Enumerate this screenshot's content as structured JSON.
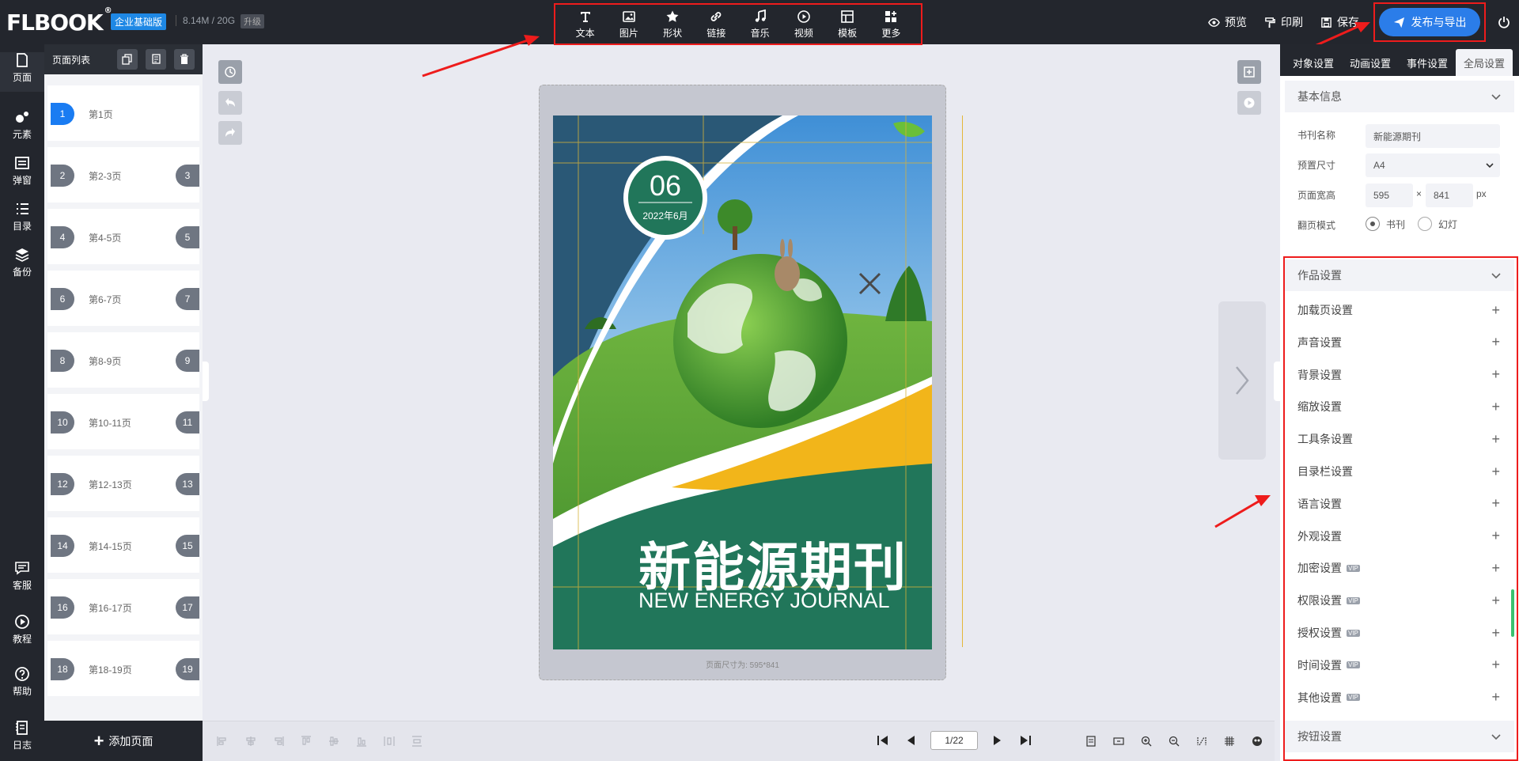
{
  "app": {
    "logo": "FLBOOK",
    "edition": "企业基础版",
    "storage": "8.14M / 20G",
    "upgrade": "升级"
  },
  "toolbar": [
    {
      "label": "文本",
      "icon": "text-icon"
    },
    {
      "label": "图片",
      "icon": "image-icon"
    },
    {
      "label": "形状",
      "icon": "star-icon"
    },
    {
      "label": "链接",
      "icon": "link-icon"
    },
    {
      "label": "音乐",
      "icon": "music-icon"
    },
    {
      "label": "视频",
      "icon": "video-icon"
    },
    {
      "label": "模板",
      "icon": "template-icon"
    },
    {
      "label": "更多",
      "icon": "more-icon"
    }
  ],
  "topright": {
    "preview": "预览",
    "print": "印刷",
    "save": "保存",
    "publish": "发布与导出"
  },
  "leftnav": [
    {
      "label": "页面",
      "icon": "page-icon"
    },
    {
      "label": "元素",
      "icon": "element-icon"
    },
    {
      "label": "弹窗",
      "icon": "popup-icon"
    },
    {
      "label": "目录",
      "icon": "list-icon"
    },
    {
      "label": "备份",
      "icon": "layers-icon"
    },
    {
      "label": "客服",
      "icon": "chat-icon"
    },
    {
      "label": "教程",
      "icon": "play-icon"
    },
    {
      "label": "帮助",
      "icon": "help-icon"
    },
    {
      "label": "日志",
      "icon": "log-icon"
    }
  ],
  "pagelist": {
    "title": "页面列表",
    "pages": [
      {
        "num": "1",
        "label": "第1页",
        "num2": ""
      },
      {
        "num": "2",
        "label": "第2-3页",
        "num2": "3"
      },
      {
        "num": "4",
        "label": "第4-5页",
        "num2": "5"
      },
      {
        "num": "6",
        "label": "第6-7页",
        "num2": "7"
      },
      {
        "num": "8",
        "label": "第8-9页",
        "num2": "9"
      },
      {
        "num": "10",
        "label": "第10-11页",
        "num2": "11"
      },
      {
        "num": "12",
        "label": "第12-13页",
        "num2": "13"
      },
      {
        "num": "14",
        "label": "第14-15页",
        "num2": "15"
      },
      {
        "num": "16",
        "label": "第16-17页",
        "num2": "17"
      },
      {
        "num": "18",
        "label": "第18-19页",
        "num2": "19"
      }
    ],
    "add": "添加页面"
  },
  "cover": {
    "issue": "06",
    "date": "2022年6月",
    "title_cn": "新能源期刊",
    "title_en": "NEW ENERGY JOURNAL",
    "colors": {
      "navy": "#2a5876",
      "green": "#21765a",
      "yellow": "#f2b51a"
    }
  },
  "canvas": {
    "size_label": "页面尺寸为: 595*841"
  },
  "pager": {
    "value": "1/22"
  },
  "rightpanel": {
    "tabs": [
      "对象设置",
      "动画设置",
      "事件设置",
      "全局设置"
    ],
    "basic": {
      "title": "基本信息",
      "name_label": "书刊名称",
      "name_value": "新能源期刊",
      "size_label": "预置尺寸",
      "size_value": "A4",
      "wh_label": "页面宽高",
      "width": "595",
      "x": "×",
      "height": "841",
      "unit": "px",
      "mode_label": "翻页模式",
      "mode_book": "书刊",
      "mode_slide": "幻灯"
    },
    "works": {
      "title": "作品设置",
      "items": [
        {
          "label": "加载页设置",
          "vip": false
        },
        {
          "label": "声音设置",
          "vip": false
        },
        {
          "label": "背景设置",
          "vip": false
        },
        {
          "label": "缩放设置",
          "vip": false
        },
        {
          "label": "工具条设置",
          "vip": false
        },
        {
          "label": "目录栏设置",
          "vip": false
        },
        {
          "label": "语言设置",
          "vip": false
        },
        {
          "label": "外观设置",
          "vip": false
        },
        {
          "label": "加密设置",
          "vip": true
        },
        {
          "label": "权限设置",
          "vip": true
        },
        {
          "label": "授权设置",
          "vip": true
        },
        {
          "label": "时间设置",
          "vip": true
        },
        {
          "label": "其他设置",
          "vip": true
        }
      ]
    },
    "buttons_title": "按钮设置",
    "vip_label": "VIP"
  }
}
